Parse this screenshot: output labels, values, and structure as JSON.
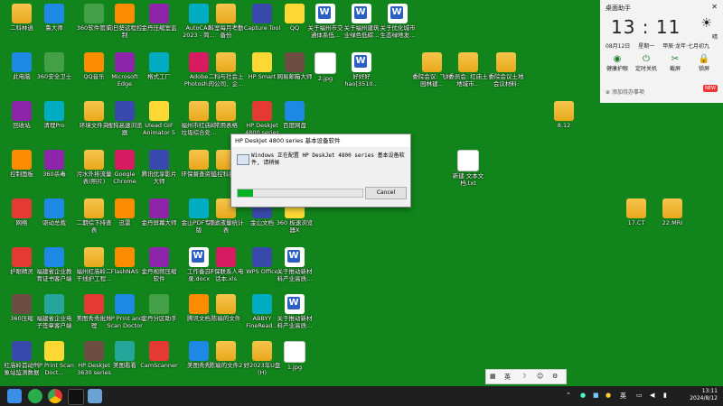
{
  "desktop": {
    "icons": [
      {
        "label": "二科林逍",
        "style": "folder"
      },
      {
        "label": "鲁大师",
        "style": "app"
      },
      {
        "label": "360软件管家",
        "style": "app"
      },
      {
        "label": "向日葵远程控制",
        "style": "app"
      },
      {
        "label": "金丹压缩室监",
        "style": "app"
      },
      {
        "label": "AutoCAD 2023 - 简...",
        "style": "app"
      },
      {
        "label": "科室每月考勤备份",
        "style": "folder"
      },
      {
        "label": "Capture Tool",
        "style": "app"
      },
      {
        "label": "QQ",
        "style": "app"
      },
      {
        "label": "关于福州市交通体系低...",
        "style": "word"
      },
      {
        "label": "关于福州建筑业绿色低碳...",
        "style": "word"
      },
      {
        "label": "关于优化城市生态绿地发...",
        "style": "word"
      },
      {
        "label": "此电脑",
        "style": "app"
      },
      {
        "label": "360安全卫士",
        "style": "app"
      },
      {
        "label": "QQ音乐",
        "style": "app"
      },
      {
        "label": "Microsoft Edge",
        "style": "app"
      },
      {
        "label": "格式工厂",
        "style": "app"
      },
      {
        "label": "Adobe Photosh...",
        "style": "app"
      },
      {
        "label": "二科与社会上的公司、企...",
        "style": "folder"
      },
      {
        "label": "HP Smart",
        "style": "app"
      },
      {
        "label": "网易邮箱大师",
        "style": "app"
      },
      {
        "label": "2.jpg",
        "style": "doc"
      },
      {
        "label": "好好好 hao[3510...",
        "style": "word"
      },
      {
        "label": "委院会议: 飞好园林建...",
        "style": "folder"
      },
      {
        "label": "委员会: 红庙土地城市...",
        "style": "folder"
      },
      {
        "label": "委院会议土地会议材料: 202...",
        "style": "folder"
      },
      {
        "label": "回收站",
        "style": "app"
      },
      {
        "label": "清理Pro",
        "style": "app"
      },
      {
        "label": "环境文件夹",
        "style": "folder"
      },
      {
        "label": "搜狗高速浏览器",
        "style": "app"
      },
      {
        "label": "Ulead GIF Animator 5",
        "style": "app"
      },
      {
        "label": "福州市红庙岭垃圾综合处...",
        "style": "folder"
      },
      {
        "label": "常用表格",
        "style": "folder"
      },
      {
        "label": "HP DeskJet 4800 series",
        "style": "app"
      },
      {
        "label": "百度网盘",
        "style": "app"
      },
      {
        "label": "8.12",
        "style": "folder"
      },
      {
        "label": "控制面板",
        "style": "app"
      },
      {
        "label": "360杀毒",
        "style": "app"
      },
      {
        "label": "污水外排流量表(照片)",
        "style": "folder"
      },
      {
        "label": "Google Chrome",
        "style": "app"
      },
      {
        "label": "腾讯优享影片大师",
        "style": "app"
      },
      {
        "label": "环保督查资料",
        "style": "folder"
      },
      {
        "label": "监控科技料",
        "style": "folder"
      },
      {
        "label": "新建 文本文档.txt",
        "style": "doc"
      },
      {
        "label": "网络",
        "style": "app"
      },
      {
        "label": "驱动总裁",
        "style": "app"
      },
      {
        "label": "二期综下排查表",
        "style": "folder"
      },
      {
        "label": "迅雷",
        "style": "app"
      },
      {
        "label": "金丹屏幕大师",
        "style": "app"
      },
      {
        "label": "金山PDF专业版",
        "style": "app"
      },
      {
        "label": "渗滤液量统计表",
        "style": "folder"
      },
      {
        "label": "金山文档",
        "style": "app"
      },
      {
        "label": "360 极速浏览器X",
        "style": "app"
      },
      {
        "label": "17.CT",
        "style": "folder"
      },
      {
        "label": "22.MRI",
        "style": "folder"
      },
      {
        "label": "护眼精灵",
        "style": "app"
      },
      {
        "label": "福建省企业教育证书客户端",
        "style": "app"
      },
      {
        "label": "福州红庙岭二干线护工程...",
        "style": "folder"
      },
      {
        "label": "FlashNAS",
        "style": "app"
      },
      {
        "label": "金丹视频压缩软件",
        "style": "app"
      },
      {
        "label": "工作备忘录.docx",
        "style": "word"
      },
      {
        "label": "环保联系人电话本.xls",
        "style": "app"
      },
      {
        "label": "WPS Office",
        "style": "app"
      },
      {
        "label": "关于推动新材料产业高质...",
        "style": "word"
      },
      {
        "label": "360压缩",
        "style": "app"
      },
      {
        "label": "福建省企业电子签章客户端",
        "style": "app"
      },
      {
        "label": "美图秀秀批处理",
        "style": "app"
      },
      {
        "label": "HP Print and Scan Doctor",
        "style": "app"
      },
      {
        "label": "金丹分区助手",
        "style": "app"
      },
      {
        "label": "腾讯文档",
        "style": "app"
      },
      {
        "label": "陈瑜的文件",
        "style": "folder"
      },
      {
        "label": "ABBYY FineRead...",
        "style": "app"
      },
      {
        "label": "关于推动新材料产业高质...",
        "style": "word"
      },
      {
        "label": "红庙岭首动气象站监测数据",
        "style": "app"
      },
      {
        "label": "HP Print Scan Doct...",
        "style": "app"
      },
      {
        "label": "HP DeskJet 3630 series",
        "style": "app"
      },
      {
        "label": "美图看看",
        "style": "app"
      },
      {
        "label": "CamScanner",
        "style": "app"
      },
      {
        "label": "美图秀秀",
        "style": "app"
      },
      {
        "label": "陈瑜的文件2",
        "style": "folder"
      },
      {
        "label": "好2023年U盘(H)",
        "style": "folder"
      },
      {
        "label": "1.jpg",
        "style": "doc"
      }
    ]
  },
  "widget": {
    "title": "桌面助手",
    "close": "✕",
    "time": "13 : 11",
    "date": "08月12日",
    "weekday": "星期一",
    "lunar": "甲辰·龙年·七月初九",
    "weather_icon": "sun-icon",
    "weather_text": "晴",
    "tools": [
      {
        "label": "健康护眼",
        "icon": "eye-icon"
      },
      {
        "label": "定时关机",
        "icon": "power-icon"
      },
      {
        "label": "截屏",
        "icon": "scissors-icon"
      },
      {
        "label": "锁屏",
        "icon": "lock-icon"
      }
    ],
    "memo_label": "添加待办事项",
    "new_badge": "NEW"
  },
  "dialog": {
    "title": "HP DeskJet 4800 series 基本设备软件",
    "message": "Windows 正在配置 HP DeskJet 4800 series 基本设备软件, 请稍候",
    "progress": 0.12,
    "cancel_label": "Cancel",
    "progress_color": "#06b025"
  },
  "ime": {
    "items": [
      "英",
      "☽",
      "⚙"
    ]
  },
  "taskbar": {
    "apps": [
      "start-icon",
      "wechat-icon",
      "chrome-icon",
      "qq-icon",
      "remote-icon",
      "active-window-icon"
    ],
    "tray": {
      "lang": "英",
      "clock_time": "13:11",
      "clock_date": "2024/8/12"
    }
  },
  "colors": {
    "desktop_bg": "#11851b",
    "taskbar_bg": "#1f1f1f"
  }
}
